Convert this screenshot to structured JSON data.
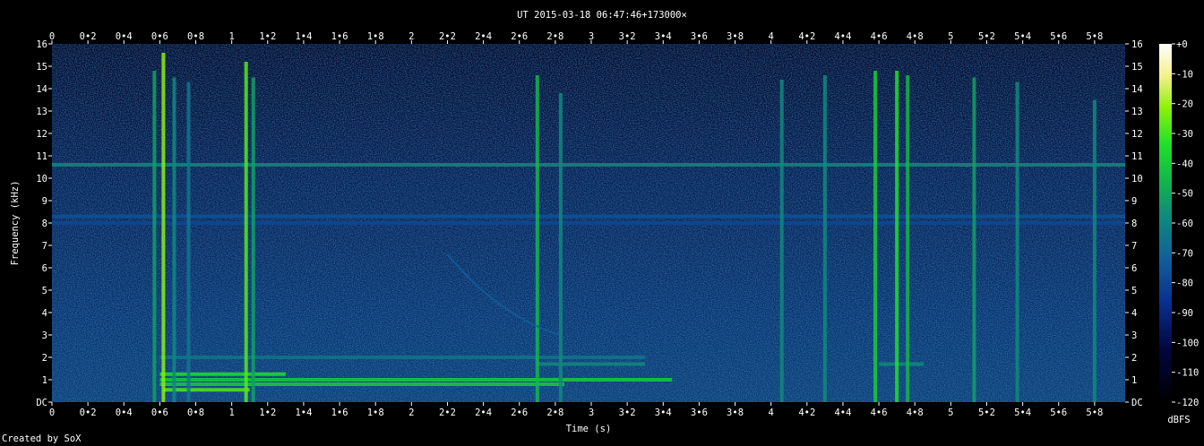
{
  "chart_data": {
    "type": "heatmap",
    "title": "UT 2015-03-18 06:47:46+173000×",
    "xlabel": "Time (s)",
    "ylabel": "Frequency (kHz)",
    "xlim": [
      0,
      5.97
    ],
    "ylim": [
      0,
      16
    ],
    "x_ticks": [
      "0",
      "0•2",
      "0•4",
      "0•6",
      "0•8",
      "1",
      "1•2",
      "1•4",
      "1•6",
      "1•8",
      "2",
      "2•2",
      "2•4",
      "2•6",
      "2•8",
      "3",
      "3•2",
      "3•4",
      "3•6",
      "3•8",
      "4",
      "4•2",
      "4•4",
      "4•6",
      "4•8",
      "5",
      "5•2",
      "5•4",
      "5•6",
      "5•8"
    ],
    "y_ticks": [
      "DC",
      "1",
      "2",
      "3",
      "4",
      "5",
      "6",
      "7",
      "8",
      "9",
      "10",
      "11",
      "12",
      "13",
      "14",
      "15",
      "16"
    ],
    "colorbar": {
      "label": "dBFS",
      "ticks": [
        "+0",
        "-10",
        "-20",
        "-30",
        "-40",
        "-50",
        "-60",
        "-70",
        "-80",
        "-90",
        "-100",
        "-110",
        "-120"
      ],
      "range": [
        -120,
        0
      ]
    },
    "background_level_dbfs": -95,
    "horizontal_lines": [
      {
        "freq_khz": 10.6,
        "x_start": 0,
        "x_end": 5.97,
        "level_dbfs": -75
      },
      {
        "freq_khz": 8.3,
        "x_start": 0,
        "x_end": 5.97,
        "level_dbfs": -88
      },
      {
        "freq_khz": 8.0,
        "x_start": 0,
        "x_end": 5.97,
        "level_dbfs": -90
      },
      {
        "freq_khz": 1.25,
        "x_start": 0.6,
        "x_end": 1.3,
        "level_dbfs": -55
      },
      {
        "freq_khz": 1.0,
        "x_start": 0.6,
        "x_end": 3.45,
        "level_dbfs": -60
      },
      {
        "freq_khz": 0.8,
        "x_start": 0.6,
        "x_end": 2.85,
        "level_dbfs": -60
      },
      {
        "freq_khz": 0.55,
        "x_start": 0.62,
        "x_end": 1.1,
        "level_dbfs": -50
      },
      {
        "freq_khz": 2.0,
        "x_start": 0.6,
        "x_end": 3.3,
        "level_dbfs": -80
      },
      {
        "freq_khz": 1.7,
        "x_start": 2.7,
        "x_end": 3.3,
        "level_dbfs": -75
      },
      {
        "freq_khz": 1.7,
        "x_start": 4.6,
        "x_end": 4.85,
        "level_dbfs": -75
      }
    ],
    "vertical_transients": [
      {
        "time_s": 0.57,
        "f_max_khz": 14.8,
        "level_dbfs": -70
      },
      {
        "time_s": 0.62,
        "f_max_khz": 15.6,
        "level_dbfs": -45
      },
      {
        "time_s": 0.68,
        "f_max_khz": 14.5,
        "level_dbfs": -75
      },
      {
        "time_s": 0.76,
        "f_max_khz": 14.3,
        "level_dbfs": -80
      },
      {
        "time_s": 1.08,
        "f_max_khz": 15.2,
        "level_dbfs": -50
      },
      {
        "time_s": 1.12,
        "f_max_khz": 14.5,
        "level_dbfs": -70
      },
      {
        "time_s": 2.7,
        "f_max_khz": 14.6,
        "level_dbfs": -65
      },
      {
        "time_s": 2.83,
        "f_max_khz": 13.8,
        "level_dbfs": -75
      },
      {
        "time_s": 4.06,
        "f_max_khz": 14.4,
        "level_dbfs": -75
      },
      {
        "time_s": 4.3,
        "f_max_khz": 14.6,
        "level_dbfs": -75
      },
      {
        "time_s": 4.58,
        "f_max_khz": 14.8,
        "level_dbfs": -60
      },
      {
        "time_s": 4.7,
        "f_max_khz": 14.8,
        "level_dbfs": -55
      },
      {
        "time_s": 4.76,
        "f_max_khz": 14.6,
        "level_dbfs": -65
      },
      {
        "time_s": 5.13,
        "f_max_khz": 14.5,
        "level_dbfs": -70
      },
      {
        "time_s": 5.37,
        "f_max_khz": 14.3,
        "level_dbfs": -75
      },
      {
        "time_s": 5.8,
        "f_max_khz": 13.5,
        "level_dbfs": -75
      }
    ],
    "sweeps": [
      {
        "t_start": 2.2,
        "f_start_khz": 6.6,
        "t_end": 2.82,
        "f_end_khz": 3.0,
        "level_dbfs": -85
      }
    ],
    "grid": false
  },
  "footer": {
    "text": "Created by SoX"
  }
}
